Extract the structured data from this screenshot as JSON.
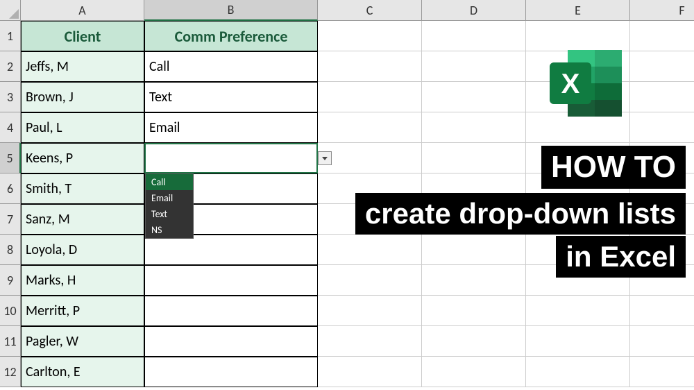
{
  "columns": [
    "A",
    "B",
    "C",
    "D",
    "E",
    "F"
  ],
  "selected_column": "B",
  "selected_row": 5,
  "headers": {
    "client": "Client",
    "pref": "Comm Preference"
  },
  "rows": [
    {
      "client": "Jeffs, M",
      "pref": "Call"
    },
    {
      "client": "Brown, J",
      "pref": "Text"
    },
    {
      "client": "Paul, L",
      "pref": "Email"
    },
    {
      "client": "Keens, P",
      "pref": ""
    },
    {
      "client": "Smith, T",
      "pref": ""
    },
    {
      "client": "Sanz, M",
      "pref": ""
    },
    {
      "client": "Loyola, D",
      "pref": ""
    },
    {
      "client": "Marks, H",
      "pref": ""
    },
    {
      "client": "Merritt, P",
      "pref": ""
    },
    {
      "client": "Pagler, W",
      "pref": ""
    },
    {
      "client": "Carlton, E",
      "pref": ""
    }
  ],
  "dropdown": {
    "options": [
      "Call",
      "Email",
      "Text",
      "NS"
    ],
    "highlighted": "Call"
  },
  "overlay": {
    "line1": "HOW TO",
    "line2": "create drop-down lists",
    "line3": "in Excel"
  },
  "icon": {
    "letter": "X"
  }
}
